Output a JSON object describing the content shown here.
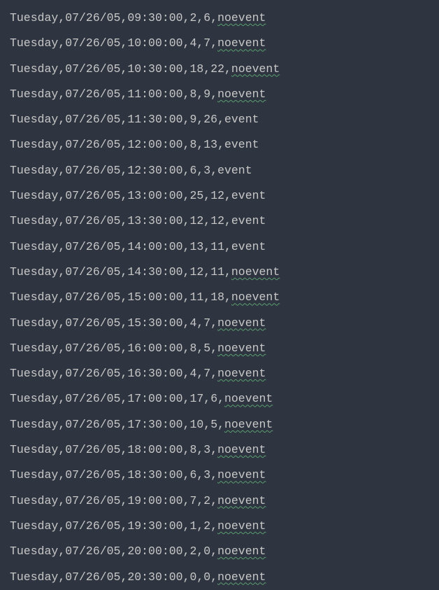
{
  "rows": [
    {
      "day": "Tuesday",
      "date": "07/26/05",
      "time": "09:30:00",
      "v1": "2",
      "v2": "6",
      "flag": "noevent",
      "spell": true
    },
    {
      "day": "Tuesday",
      "date": "07/26/05",
      "time": "10:00:00",
      "v1": "4",
      "v2": "7",
      "flag": "noevent",
      "spell": true
    },
    {
      "day": "Tuesday",
      "date": "07/26/05",
      "time": "10:30:00",
      "v1": "18",
      "v2": "22",
      "flag": "noevent",
      "spell": true
    },
    {
      "day": "Tuesday",
      "date": "07/26/05",
      "time": "11:00:00",
      "v1": "8",
      "v2": "9",
      "flag": "noevent",
      "spell": true
    },
    {
      "day": "Tuesday",
      "date": "07/26/05",
      "time": "11:30:00",
      "v1": "9",
      "v2": "26",
      "flag": "event",
      "spell": false
    },
    {
      "day": "Tuesday",
      "date": "07/26/05",
      "time": "12:00:00",
      "v1": "8",
      "v2": "13",
      "flag": "event",
      "spell": false
    },
    {
      "day": "Tuesday",
      "date": "07/26/05",
      "time": "12:30:00",
      "v1": "6",
      "v2": "3",
      "flag": "event",
      "spell": false
    },
    {
      "day": "Tuesday",
      "date": "07/26/05",
      "time": "13:00:00",
      "v1": "25",
      "v2": "12",
      "flag": "event",
      "spell": false
    },
    {
      "day": "Tuesday",
      "date": "07/26/05",
      "time": "13:30:00",
      "v1": "12",
      "v2": "12",
      "flag": "event",
      "spell": false
    },
    {
      "day": "Tuesday",
      "date": "07/26/05",
      "time": "14:00:00",
      "v1": "13",
      "v2": "11",
      "flag": "event",
      "spell": false
    },
    {
      "day": "Tuesday",
      "date": "07/26/05",
      "time": "14:30:00",
      "v1": "12",
      "v2": "11",
      "flag": "noevent",
      "spell": true
    },
    {
      "day": "Tuesday",
      "date": "07/26/05",
      "time": "15:00:00",
      "v1": "11",
      "v2": "18",
      "flag": "noevent",
      "spell": true
    },
    {
      "day": "Tuesday",
      "date": "07/26/05",
      "time": "15:30:00",
      "v1": "4",
      "v2": "7",
      "flag": "noevent",
      "spell": true
    },
    {
      "day": "Tuesday",
      "date": "07/26/05",
      "time": "16:00:00",
      "v1": "8",
      "v2": "5",
      "flag": "noevent",
      "spell": true
    },
    {
      "day": "Tuesday",
      "date": "07/26/05",
      "time": "16:30:00",
      "v1": "4",
      "v2": "7",
      "flag": "noevent",
      "spell": true
    },
    {
      "day": "Tuesday",
      "date": "07/26/05",
      "time": "17:00:00",
      "v1": "17",
      "v2": "6",
      "flag": "noevent",
      "spell": true
    },
    {
      "day": "Tuesday",
      "date": "07/26/05",
      "time": "17:30:00",
      "v1": "10",
      "v2": "5",
      "flag": "noevent",
      "spell": true
    },
    {
      "day": "Tuesday",
      "date": "07/26/05",
      "time": "18:00:00",
      "v1": "8",
      "v2": "3",
      "flag": "noevent",
      "spell": true
    },
    {
      "day": "Tuesday",
      "date": "07/26/05",
      "time": "18:30:00",
      "v1": "6",
      "v2": "3",
      "flag": "noevent",
      "spell": true
    },
    {
      "day": "Tuesday",
      "date": "07/26/05",
      "time": "19:00:00",
      "v1": "7",
      "v2": "2",
      "flag": "noevent",
      "spell": true
    },
    {
      "day": "Tuesday",
      "date": "07/26/05",
      "time": "19:30:00",
      "v1": "1",
      "v2": "2",
      "flag": "noevent",
      "spell": true
    },
    {
      "day": "Tuesday",
      "date": "07/26/05",
      "time": "20:00:00",
      "v1": "2",
      "v2": "0",
      "flag": "noevent",
      "spell": true
    },
    {
      "day": "Tuesday",
      "date": "07/26/05",
      "time": "20:30:00",
      "v1": "0",
      "v2": "0",
      "flag": "noevent",
      "spell": true
    }
  ]
}
